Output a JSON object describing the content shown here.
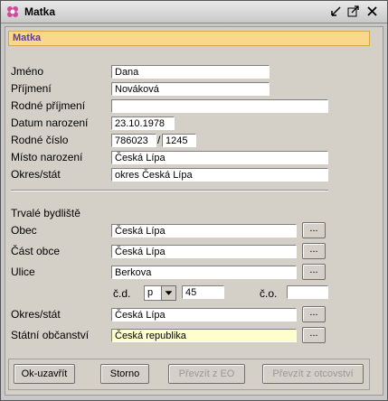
{
  "window": {
    "title": "Matka"
  },
  "section": {
    "title": "Matka"
  },
  "person": {
    "jmeno_label": "Jméno",
    "jmeno": "Dana",
    "prijmeni_label": "Příjmení",
    "prijmeni": "Nováková",
    "rodne_prijmeni_label": "Rodné příjmení",
    "rodne_prijmeni": "",
    "datum_label": "Datum narození",
    "datum": "23.10.1978",
    "rc_label": "Rodné číslo",
    "rc1": "786023",
    "rc_slash": "/",
    "rc2": "1245",
    "misto_label": "Místo narození",
    "misto": "Česká Lípa",
    "okres_label": "Okres/stát",
    "okres": "okres Česká Lípa"
  },
  "address": {
    "heading": "Trvalé bydliště",
    "obec_label": "Obec",
    "obec": "Česká Lípa",
    "cast_label": "Část obce",
    "cast": "Česká Lípa",
    "ulice_label": "Ulice",
    "ulice": "Berkova",
    "cd_label": "č.d.",
    "cd_type": "p",
    "cd_value": "45",
    "co_label": "č.o.",
    "co_value": "",
    "okres_label": "Okres/stát",
    "okres": "Česká Lípa",
    "obcanstvi_label": "Státní občanství",
    "obcanstvi": "Česká republika",
    "dots_label": "..."
  },
  "buttons": {
    "ok": "Ok-uzavřít",
    "storno": "Storno",
    "prevzit_eo": "Převzít z EO",
    "prevzit_otcovstvi": "Převzít z otcovství"
  }
}
